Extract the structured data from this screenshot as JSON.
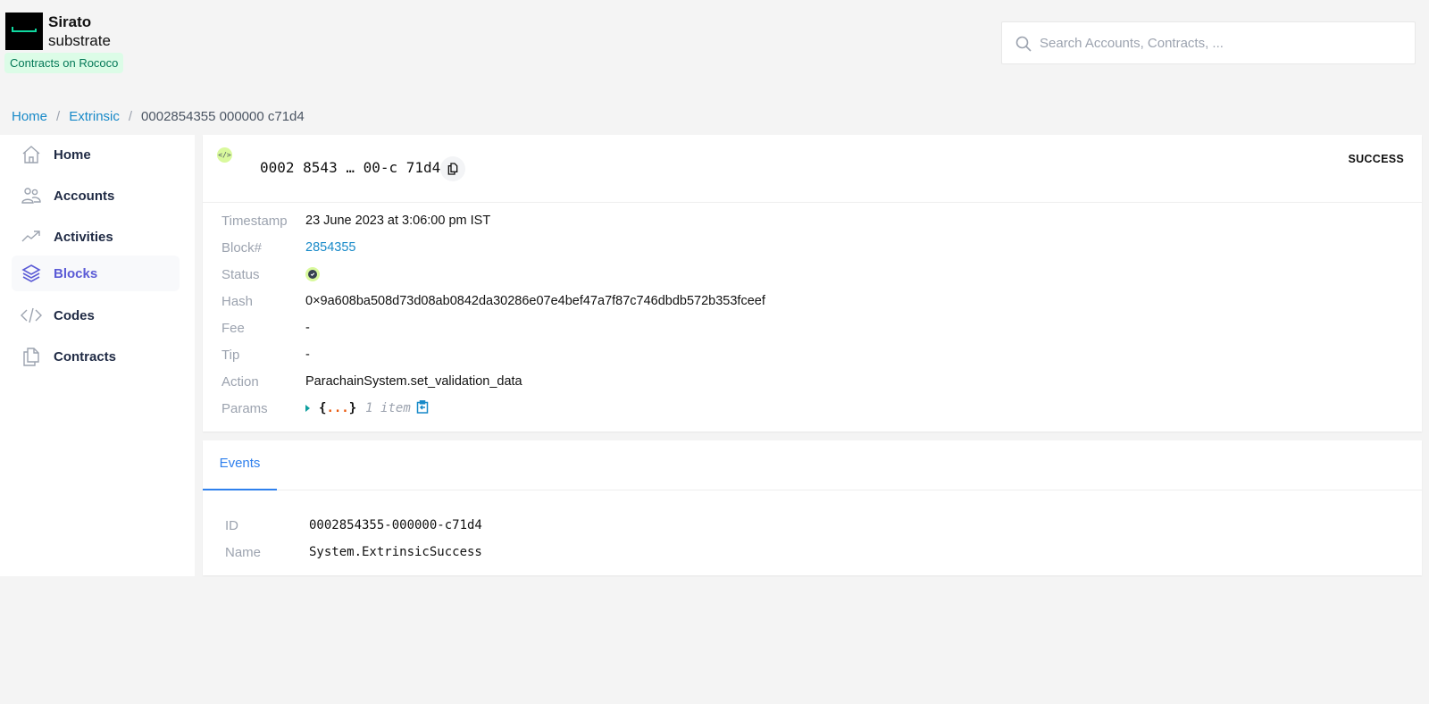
{
  "brand": {
    "title": "Sirato",
    "subtitle": "substrate",
    "network_badge": "Contracts on Rococo"
  },
  "search": {
    "placeholder": "Search Accounts, Contracts, ...",
    "value": ""
  },
  "breadcrumb": {
    "items": [
      {
        "label": "Home"
      },
      {
        "label": "Extrinsic"
      },
      {
        "label": "0002854355 000000 c71d4"
      }
    ],
    "separator": "/"
  },
  "sidebar": {
    "items": [
      {
        "label": "Home",
        "icon": "home-icon"
      },
      {
        "label": "Accounts",
        "icon": "users-icon"
      },
      {
        "label": "Activities",
        "icon": "trending-icon"
      },
      {
        "label": "Blocks",
        "icon": "layers-icon",
        "active": true
      },
      {
        "label": "Codes",
        "icon": "code-icon"
      },
      {
        "label": "Contracts",
        "icon": "documents-icon"
      }
    ]
  },
  "extrinsic": {
    "badge_glyph": "</>",
    "id_short": "0002 8543 … 00-c 71d4",
    "status": "SUCCESS",
    "fields": {
      "timestamp": {
        "label": "Timestamp",
        "value": "23 June 2023 at 3:06:00 pm IST"
      },
      "block": {
        "label": "Block#",
        "value": "2854355"
      },
      "status": {
        "label": "Status",
        "icon": "check-circle-icon"
      },
      "hash": {
        "label": "Hash",
        "value": "0×9a608ba508d73d08ab0842da30286e07e4bef47a7f87c746dbdb572b353fceef"
      },
      "fee": {
        "label": "Fee",
        "value": "-"
      },
      "tip": {
        "label": "Tip",
        "value": "-"
      },
      "action": {
        "label": "Action",
        "value": "ParachainSystem.set_validation_data"
      },
      "params": {
        "label": "Params",
        "open_brace": "{",
        "dots": "...",
        "close_brace": "}",
        "count": "1 item"
      }
    }
  },
  "events": {
    "tab_label": "Events",
    "rows": [
      {
        "label": "ID",
        "value": "0002854355-000000-c71d4"
      },
      {
        "label": "Name",
        "value": "System.ExtrinsicSuccess"
      }
    ]
  },
  "colors": {
    "accent": "#5b5bd6",
    "link": "#1789c8",
    "tab": "#2f80ed",
    "success_badge": "#d9f99d",
    "network_badge_bg": "#dcfce7",
    "network_badge_fg": "#047857"
  }
}
